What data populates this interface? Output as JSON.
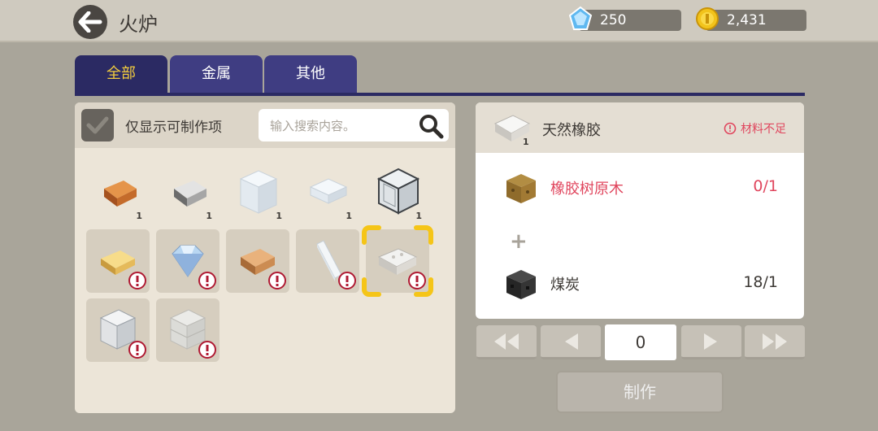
{
  "header": {
    "title": "火炉"
  },
  "currency": {
    "diamonds": "250",
    "coins": "2,431"
  },
  "tabs": [
    {
      "label": "全部"
    },
    {
      "label": "金属"
    },
    {
      "label": "其他"
    }
  ],
  "filter": {
    "label": "仅显示可制作项",
    "search_placeholder": "输入搜索内容。"
  },
  "inventory": {
    "row1": [
      {
        "name": "copper-ingot",
        "qty": "1"
      },
      {
        "name": "iron-ingot",
        "qty": "1"
      },
      {
        "name": "glass-block",
        "qty": "1"
      },
      {
        "name": "glass-pane",
        "qty": "1"
      },
      {
        "name": "quartz-block",
        "qty": "1"
      }
    ],
    "row2": [
      "gold-ingot",
      "diamond",
      "brick",
      "glass-sheet",
      "rubber-selected"
    ],
    "row3": [
      "white-block",
      "stone-brick-block"
    ]
  },
  "recipe": {
    "name": "天然橡胶",
    "qty": "1",
    "status": "材料不足",
    "materials": [
      {
        "name": "橡胶树原木",
        "count": "0/1",
        "color": "#e0455d"
      },
      {
        "name": "煤炭",
        "count": "18/1",
        "color": "#3d3935"
      }
    ]
  },
  "quantity": "0",
  "craft_label": "制作"
}
